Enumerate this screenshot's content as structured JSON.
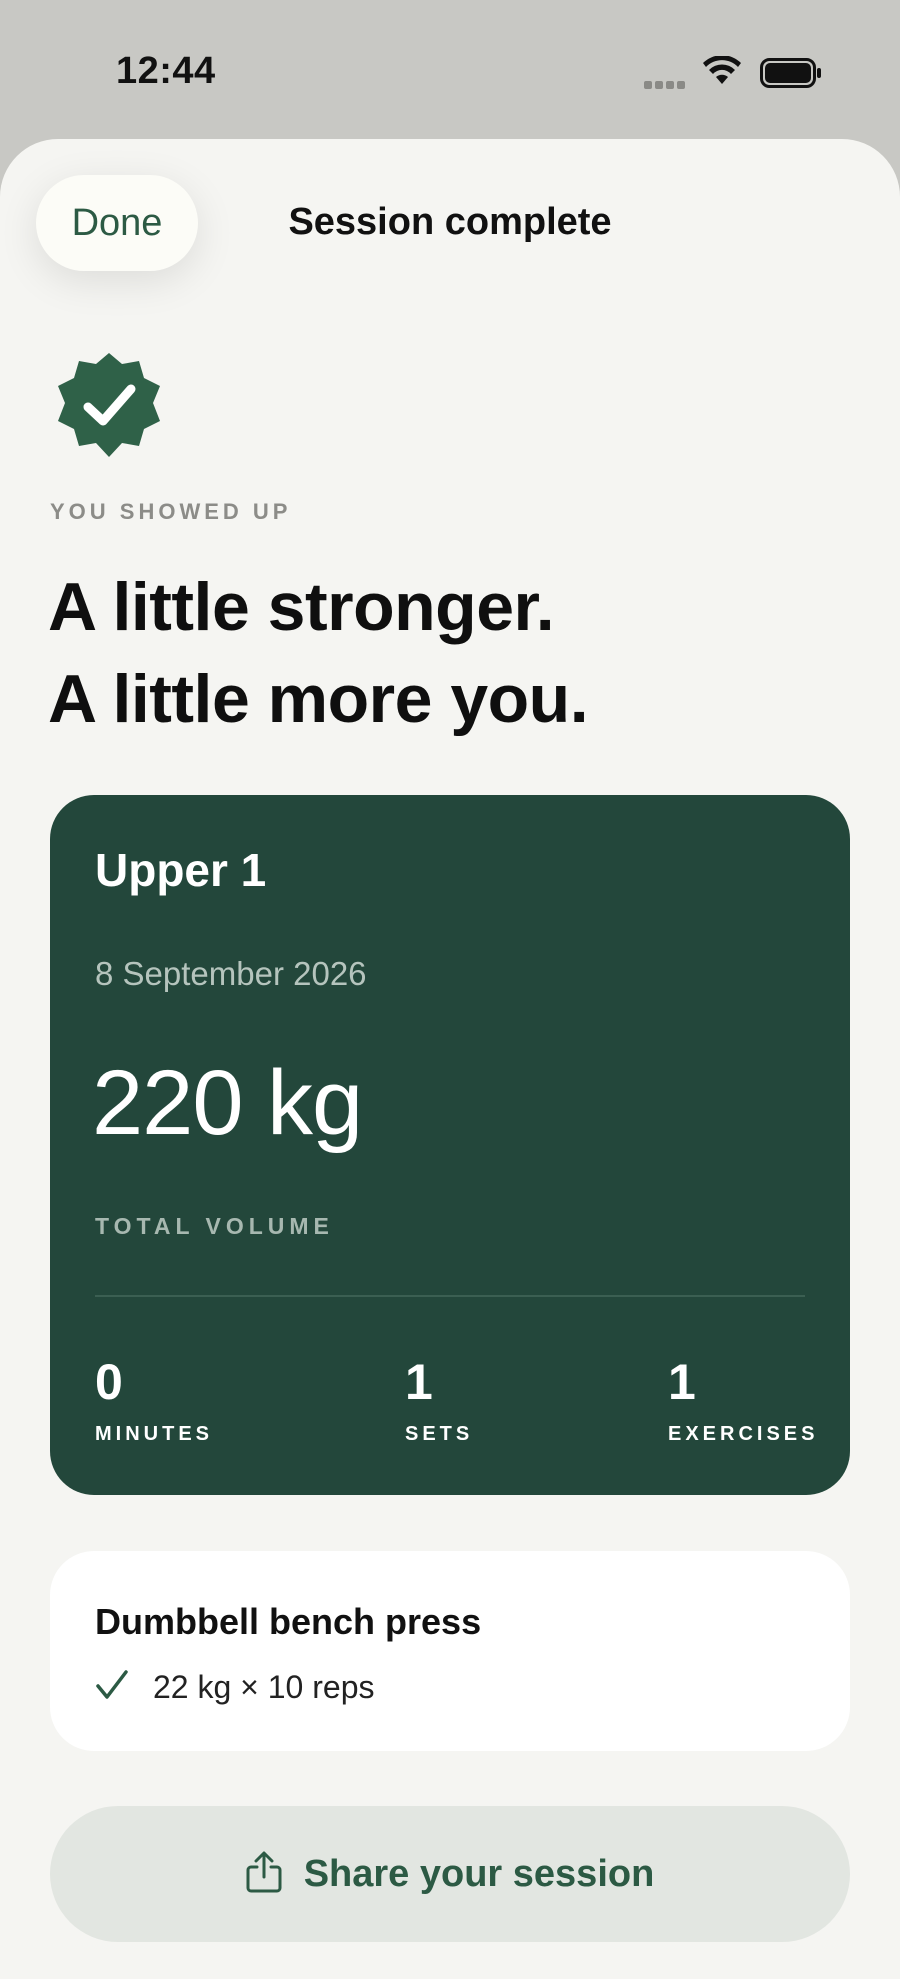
{
  "status_bar": {
    "time": "12:44"
  },
  "header": {
    "done_label": "Done",
    "title": "Session complete"
  },
  "hero": {
    "eyebrow": "YOU SHOWED UP",
    "headline_line1": "A little stronger.",
    "headline_line2": "A little more you."
  },
  "summary": {
    "workout_name": "Upper 1",
    "date": "8 September 2026",
    "total_volume": "220 kg",
    "total_volume_label": "TOTAL VOLUME",
    "stats": [
      {
        "value": "0",
        "label": "MINUTES"
      },
      {
        "value": "1",
        "label": "SETS"
      },
      {
        "value": "1",
        "label": "EXERCISES"
      }
    ]
  },
  "exercises": [
    {
      "name": "Dumbbell bench press",
      "sets": [
        "22 kg × 10 reps"
      ]
    }
  ],
  "share": {
    "label": "Share your session"
  },
  "colors": {
    "accent": "#23473b",
    "accent_text": "#2c5a44",
    "background": "#f5f5f2"
  }
}
